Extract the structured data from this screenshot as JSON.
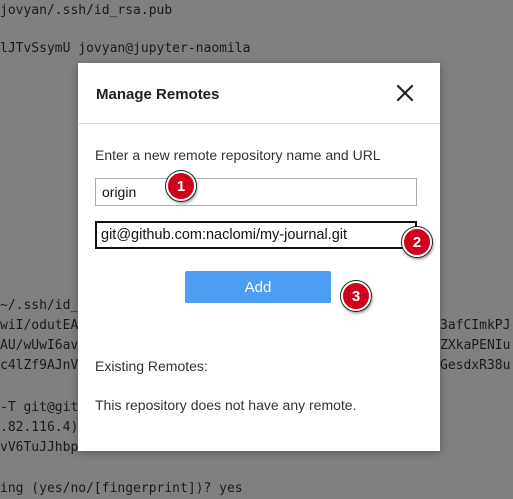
{
  "terminal": {
    "lines": [
      "jovyan/.ssh/id_rsa.pub",
      "lJTvSsymU jovyan@jupyter-naomila",
      "~/.ssh/id_",
      "wiI/odutEA",
      "AU/wUwI6av",
      "c4lZf9AJnV",
      "-T git@git",
      ".82.116.4)",
      "vV6TuJJhbp",
      "ing (yes/no/[fingerprint])? yes"
    ],
    "right_fragments": [
      "3afCImkPJ",
      "ZXkaPENIu",
      "GesdxR38u"
    ]
  },
  "modal": {
    "title": "Manage Remotes",
    "close_icon": "close-icon",
    "prompt": "Enter a new remote repository name and URL",
    "name_value": "origin",
    "url_value": "git@github.com:naclomi/my-journal.git",
    "add_label": "Add",
    "existing_label": "Existing Remotes:",
    "no_remote_text": "This repository does not have any remote."
  },
  "markers": [
    "1",
    "2",
    "3"
  ],
  "colors": {
    "backdrop": "#808080",
    "accent": "#4d9ef3",
    "marker": "#d0021b"
  }
}
